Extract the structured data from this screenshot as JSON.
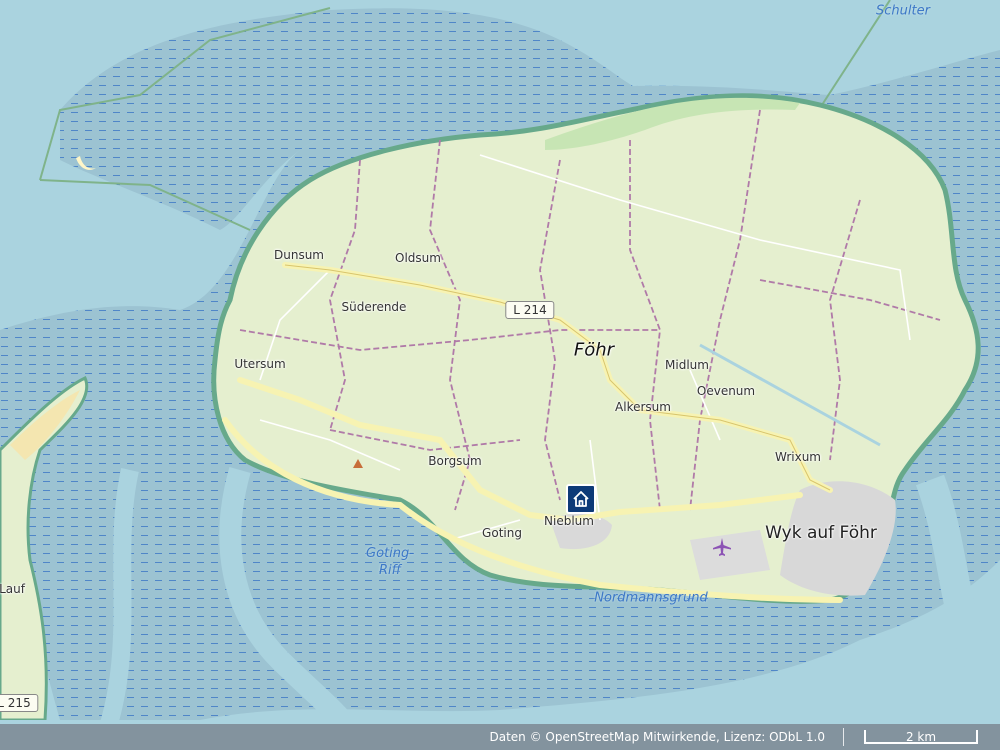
{
  "places": {
    "dunsum": "Dunsum",
    "oldsum": "Oldsum",
    "suderende": "Süderende",
    "utersum": "Utersum",
    "borgsum": "Borgsum",
    "goting": "Goting",
    "nieblum": "Nieblum",
    "alkersum": "Alkersum",
    "midlum": "Midlum",
    "oevenum": "Oevenum",
    "wrixum": "Wrixum",
    "wyk": "Wyk auf Föhr",
    "fohr": "Föhr",
    "amrum_partial": "Lauf"
  },
  "water_labels": {
    "schulter": "Schulter",
    "goting_riff_1": "Goting-",
    "goting_riff_2": "Riff",
    "nordmannsgrund": "Nordmannsgrund"
  },
  "roads": {
    "l214": "L 214",
    "l215_partial": "L 215"
  },
  "footer": {
    "attribution": "Daten © OpenStreetMap Mitwirkende, Lizenz: ODbL 1.0",
    "scale": "2 km"
  },
  "colors": {
    "water": "#aad3df",
    "tidal_flat": "#9cc3d2",
    "land": "#e5efcf",
    "marker": "#0d3a78"
  },
  "icons": {
    "marker": "home-icon",
    "airport": "airplane-icon"
  }
}
